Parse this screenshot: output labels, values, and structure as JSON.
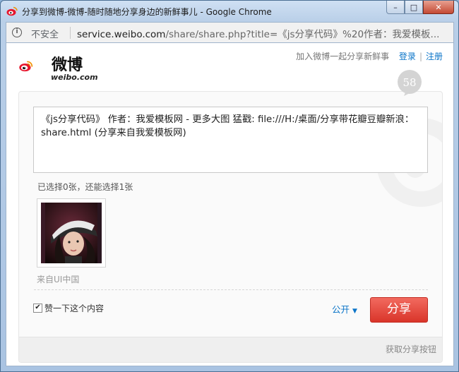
{
  "window": {
    "title": "分享到微博-微博-随时随地分享身边的新鲜事儿 - Google Chrome",
    "controls": {
      "minimize": "–",
      "maximize": "□",
      "close": "✕"
    }
  },
  "address_bar": {
    "security_label": "不安全",
    "url_host": "service.weibo.com",
    "url_rest": "/share/share.php?title=《js分享代码》%20作者：我爱模板..."
  },
  "header": {
    "brand_cn": "微博",
    "brand_en": "weibo.com",
    "tagline": "加入微博一起分享新鲜事",
    "login": "登录",
    "register": "注册"
  },
  "composer": {
    "remaining_count": "58",
    "text": "《js分享代码》 作者：我爱模板网 - 更多大图 猛戳: file:///H:/桌面/分享带花瓣豆瓣新浪：share.html (分享来自我爱模板网)",
    "images_note": "已选择0张，还能选择1张",
    "source_note": "来自UI中国",
    "like_checked": true,
    "like_label": "赞一下这个内容",
    "visibility": "公开",
    "share_button": "分享"
  },
  "footer": {
    "get_button_link": "获取分享按钮"
  },
  "colors": {
    "accent_red": "#e0392d",
    "link_blue": "#0a74c8"
  }
}
